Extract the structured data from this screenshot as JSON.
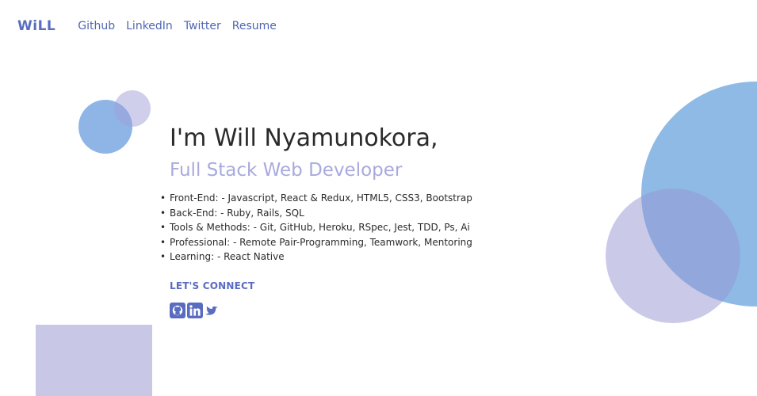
{
  "nav": {
    "logo": "WiLL",
    "links": [
      "Github",
      "LinkedIn",
      "Twitter",
      "Resume"
    ]
  },
  "hero": {
    "title": "I'm Will Nyamunokora,",
    "subtitle": "Full Stack Web Developer",
    "skills": [
      "Front-End: - Javascript, React & Redux, HTML5, CSS3, Bootstrap",
      "Back-End: - Ruby, Rails, SQL",
      "Tools & Methods: - Git, GitHub, Heroku, RSpec, Jest, TDD, Ps, Ai",
      "Professional: - Remote Pair-Programming, Teamwork, Mentoring",
      "Learning: - React Native"
    ],
    "connect_label": "LET'S CONNECT"
  },
  "socials": [
    "github-icon",
    "linkedin-icon",
    "twitter-icon"
  ],
  "colors": {
    "accent": "#5a6cc0",
    "subtitle": "#a8aade",
    "blue_shape": "#8fbae6",
    "lavender_shape": "#c8c8e6"
  }
}
